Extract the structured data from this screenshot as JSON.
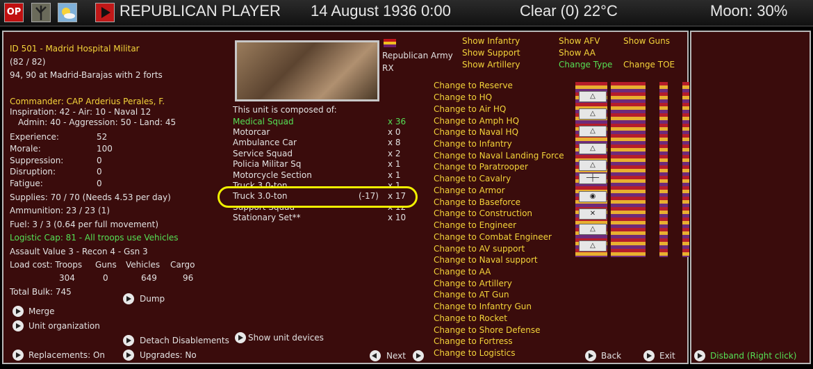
{
  "topbar": {
    "op": "OP",
    "player": "REPUBLICAN PLAYER",
    "date": "14 August 1936 0:00",
    "weather": "Clear (0) 22°C",
    "moon": "Moon: 30%"
  },
  "unit": {
    "id_line": "ID 501 - Madrid Hospital Militar",
    "strength": "(82 / 82)",
    "location": "94, 90 at Madrid-Barajas with 2 forts",
    "commander": "Commander: CAP Arderius Perales, F.",
    "ratings1": "Inspiration: 42 - Air: 10 - Naval 12",
    "ratings2": "Admin: 40 - Aggression: 50 - Land: 45",
    "stats": [
      {
        "label": "Experience:",
        "value": "52"
      },
      {
        "label": "Morale:",
        "value": "100"
      },
      {
        "label": "Suppression:",
        "value": "0"
      },
      {
        "label": "Disruption:",
        "value": "0"
      },
      {
        "label": "Fatigue:",
        "value": "0"
      }
    ],
    "supplies": "Supplies: 70 / 70 (Needs 4.53 per day)",
    "ammunition": "Ammunition: 23 / 23 (1)",
    "fuel": "Fuel: 3 / 3 (0.64 per full movement)",
    "logistic": "Logistic Cap: 81 - All troops use Vehicles",
    "assault": "Assault Value 3 - Recon 4 - Gsn 3",
    "load_headers": [
      "Load cost: Troops",
      "Guns",
      "Vehicles",
      "Cargo"
    ],
    "load_values": [
      "304",
      "0",
      "649",
      "96"
    ],
    "bulk": "Total Bulk: 745"
  },
  "army": {
    "name": "Republican Army",
    "code": "RX"
  },
  "composition": {
    "title": "This unit is composed of:",
    "items": [
      {
        "name": "Medical Squad",
        "count": "x 36"
      },
      {
        "name": "Motorcar",
        "count": "x 0"
      },
      {
        "name": "Ambulance Car",
        "count": "x 8"
      },
      {
        "name": "Service Squad",
        "count": "x 2"
      },
      {
        "name": "Policia Militar Sq",
        "count": "x 1"
      },
      {
        "name": "Motorcycle Section",
        "count": "x 1"
      },
      {
        "name": "Truck 3.0-ton",
        "count": "x 1"
      },
      {
        "name": "Truck 3.0-ton",
        "delta": "(-17)",
        "count": "x 17"
      },
      {
        "name": "Support Squad",
        "count": "x 12"
      },
      {
        "name": "Stationary Set**",
        "count": "x 10"
      }
    ]
  },
  "filters": [
    "Show Infantry",
    "Show AFV",
    "Show Guns",
    "Show Support",
    "Show AA",
    "Show Artillery",
    "Change Type",
    "Change TOE"
  ],
  "change_types": [
    "Change to Reserve",
    "Change to HQ",
    "Change to Air HQ",
    "Change to Amph HQ",
    "Change to Naval HQ",
    "Change to Infantry",
    "Change to Naval Landing Force",
    "Change to Paratrooper",
    "Change to Cavalry",
    "Change to Armor",
    "Change to Baseforce",
    "Change to Construction",
    "Change to Engineer",
    "Change to Combat Engineer",
    "Change to AV support",
    "Change to Naval support",
    "Change to AA",
    "Change to Artillery",
    "Change to AT Gun",
    "Change to Infantry Gun",
    "Change to Rocket",
    "Change to Shore Defense",
    "Change to Fortress",
    "Change to Logistics"
  ],
  "unit_icons": [
    "△",
    "△",
    "△",
    "△",
    "△",
    "─┼─",
    "◉",
    "✕",
    "△",
    "",
    "◎",
    "⌒",
    "△"
  ],
  "actions": {
    "merge": "Merge",
    "organization": "Unit organization",
    "dump": "Dump",
    "detach": "Detach Disablements",
    "devices": "Show unit devices",
    "replacements": "Replacements: On",
    "upgrades": "Upgrades: No",
    "next": "Next",
    "back": "Back",
    "exit": "Exit",
    "disband": "Disband (Right click)"
  },
  "colors": {
    "panel": "#3a0c0c",
    "yellow": "#f4d43a",
    "green": "#55e055",
    "highlight": "#f0f000"
  }
}
